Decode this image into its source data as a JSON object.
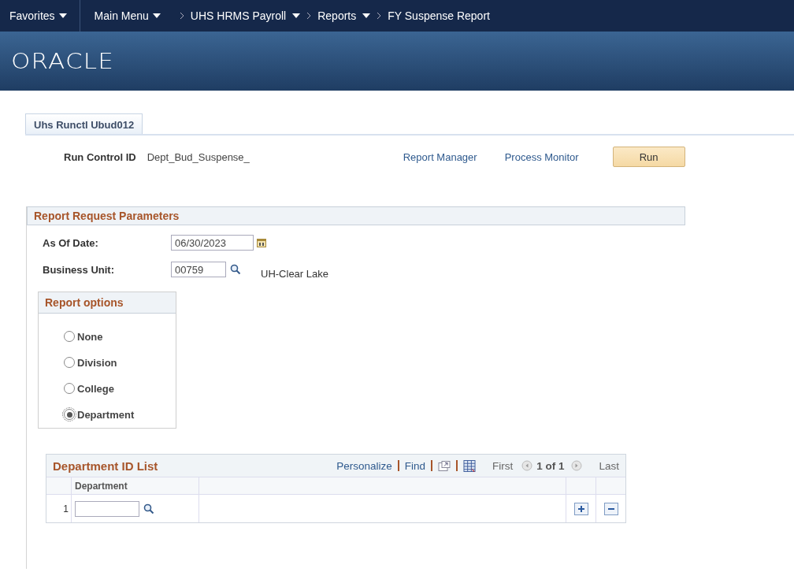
{
  "nav": {
    "favorites": "Favorites",
    "main_menu": "Main Menu",
    "breadcrumbs": [
      {
        "label": "UHS HRMS Payroll",
        "dropdown": true
      },
      {
        "label": "Reports",
        "dropdown": true
      },
      {
        "label": "FY Suspense Report",
        "dropdown": false
      }
    ]
  },
  "logo": "ORACLE",
  "tabs": [
    {
      "label": "Uhs Runctl Ubud012",
      "selected": true
    }
  ],
  "run_control": {
    "label": "Run Control ID",
    "value": "Dept_Bud_Suspense_",
    "links": [
      "Report Manager",
      "Process Monitor"
    ],
    "run_button": "Run"
  },
  "parameters": {
    "title": "Report Request Parameters",
    "as_of_date": {
      "label": "As Of Date:",
      "value": "06/30/2023"
    },
    "business_unit": {
      "label": "Business Unit:",
      "value": "00759",
      "description": "UH-Clear Lake"
    }
  },
  "report_options": {
    "title": "Report options",
    "options": [
      {
        "label": "None",
        "selected": false
      },
      {
        "label": "Division",
        "selected": false
      },
      {
        "label": "College",
        "selected": false
      },
      {
        "label": "Department",
        "selected": true
      }
    ]
  },
  "department_grid": {
    "title": "Department ID List",
    "personalize": "Personalize",
    "find": "Find",
    "first": "First",
    "count": "1 of 1",
    "last": "Last",
    "column": "Department",
    "rows": [
      {
        "number": "1",
        "value": ""
      }
    ]
  }
}
